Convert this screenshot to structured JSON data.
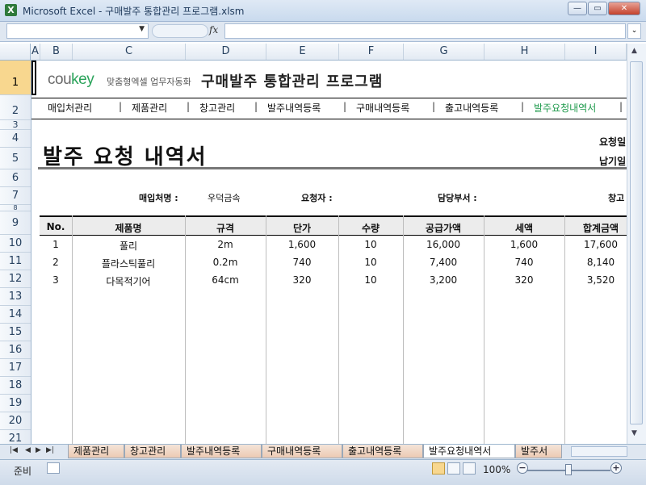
{
  "window": {
    "title": "Microsoft Excel - 구매발주 통합관리 프로그램.xlsm",
    "app_icon": "X"
  },
  "formula_bar": {
    "fx": "fx",
    "expand": "⌄"
  },
  "columns": [
    "A",
    "B",
    "C",
    "D",
    "E",
    "F",
    "G",
    "H",
    "I"
  ],
  "rows": [
    "1",
    "2",
    "3",
    "4",
    "5",
    "6",
    "7",
    "8",
    "9",
    "10",
    "11",
    "12",
    "13",
    "14",
    "15",
    "16",
    "17",
    "18",
    "19",
    "20",
    "21"
  ],
  "header": {
    "logo_co": "cou",
    "logo_key": "key",
    "logo_tagline": "맞춤형엑셀 업무자동화",
    "title": "구매발주 통합관리 프로그램"
  },
  "nav": [
    "매입처관리",
    "제품관리",
    "창고관리",
    "발주내역등록",
    "구매내역등록",
    "출고내역등록",
    "발주요청내역서"
  ],
  "report": {
    "title": "발주 요청 내역서",
    "request_date_label": "요청일",
    "delivery_date_label": "납기일",
    "supplier_label": "매입처명 :",
    "supplier_value": "우덕금속",
    "requester_label": "요청자 :",
    "department_label": "담당부서 :",
    "warehouse_label": "창고"
  },
  "table": {
    "headers": [
      "No.",
      "제품명",
      "규격",
      "단가",
      "수량",
      "공급가액",
      "세액",
      "합계금액"
    ],
    "rows": [
      [
        "1",
        "풀리",
        "2m",
        "1,600",
        "10",
        "16,000",
        "1,600",
        "17,600"
      ],
      [
        "2",
        "플라스틱풀리",
        "0.2m",
        "740",
        "10",
        "7,400",
        "740",
        "8,140"
      ],
      [
        "3",
        "다목적기어",
        "64cm",
        "320",
        "10",
        "3,200",
        "320",
        "3,520"
      ]
    ]
  },
  "sheet_tabs": [
    "제품관리",
    "창고관리",
    "발주내역등록",
    "구매내역등록",
    "출고내역등록",
    "발주요청내역서",
    "발주서"
  ],
  "active_tab": "발주요청내역서",
  "status": {
    "ready": "준비",
    "zoom": "100%"
  }
}
